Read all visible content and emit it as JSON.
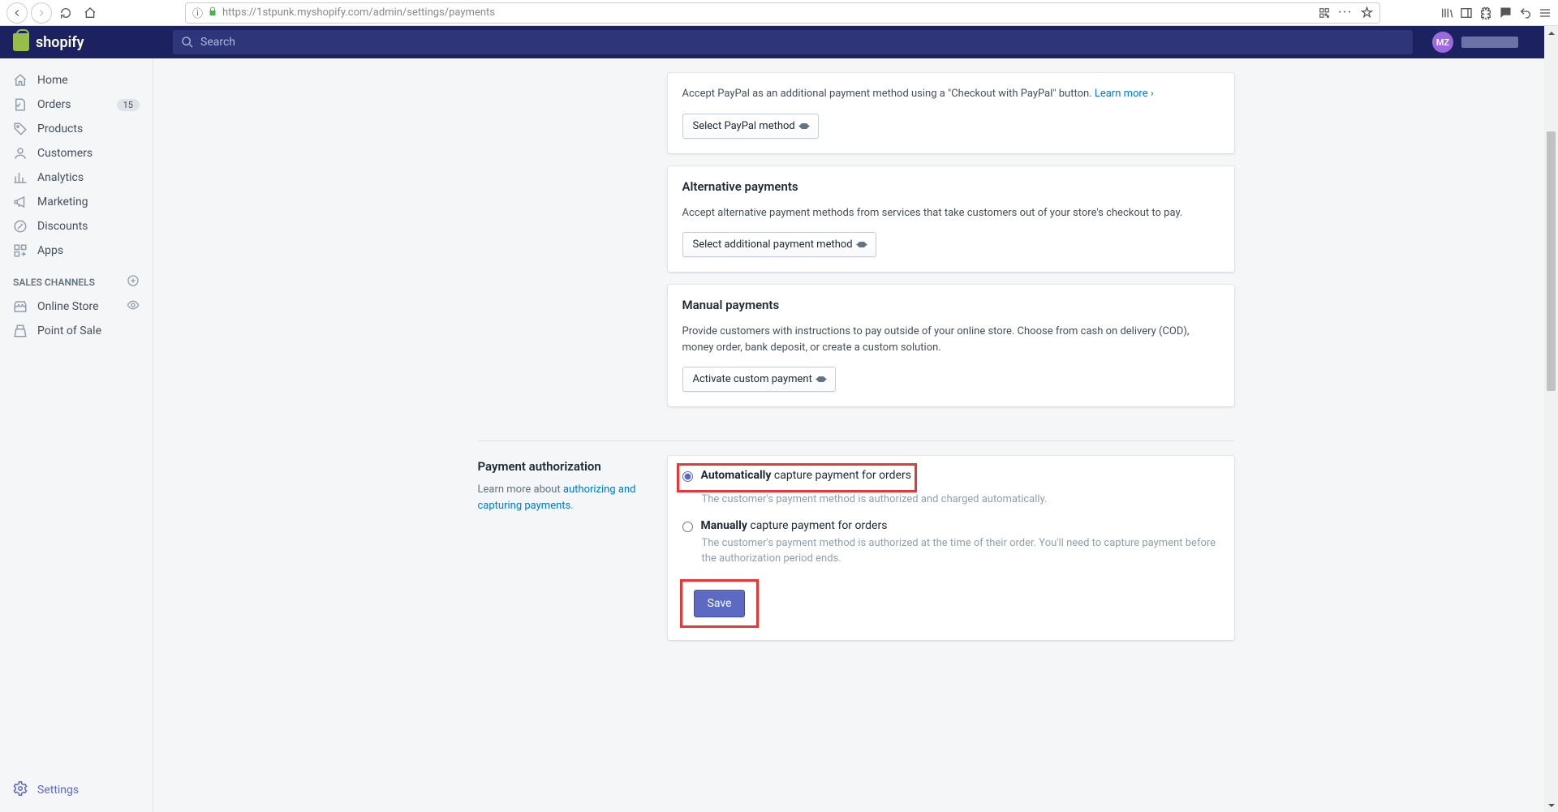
{
  "browser": {
    "url_domain": "https://1stpunk.myshopify.com",
    "url_path": "/admin/settings/payments"
  },
  "topbar": {
    "brand": "shopify",
    "search_placeholder": "Search",
    "user_initials": "MZ"
  },
  "sidebar": {
    "items": [
      {
        "label": "Home"
      },
      {
        "label": "Orders",
        "badge": "15"
      },
      {
        "label": "Products"
      },
      {
        "label": "Customers"
      },
      {
        "label": "Analytics"
      },
      {
        "label": "Marketing"
      },
      {
        "label": "Discounts"
      },
      {
        "label": "Apps"
      }
    ],
    "channels_header": "SALES CHANNELS",
    "channels": [
      {
        "label": "Online Store"
      },
      {
        "label": "Point of Sale"
      }
    ],
    "settings_label": "Settings"
  },
  "panels": {
    "paypal": {
      "desc_pre": "Accept PayPal as an additional payment method using a \"Checkout with PayPal\" button. ",
      "learn_more": "Learn more ›",
      "select_label": "Select PayPal method"
    },
    "alternative": {
      "title": "Alternative payments",
      "desc": "Accept alternative payment methods from services that take customers out of your store's checkout to pay.",
      "select_label": "Select additional payment method"
    },
    "manual": {
      "title": "Manual payments",
      "desc": "Provide customers with instructions to pay outside of your online store. Choose from cash on delivery (COD), money order, bank deposit, or create a custom solution.",
      "select_label": "Activate custom payment"
    }
  },
  "auth": {
    "title": "Payment authorization",
    "learn_pre": "Learn more about ",
    "learn_link": "authorizing and capturing payments",
    "opt_auto_bold": "Automatically",
    "opt_auto_rest": " capture payment for orders",
    "opt_auto_desc": "The customer's payment method is authorized and charged automatically.",
    "opt_manual_bold": "Manually",
    "opt_manual_rest": " capture payment for orders",
    "opt_manual_desc": "The customer's payment method is authorized at the time of their order. You'll need to capture payment before the authorization period ends.",
    "save_label": "Save"
  }
}
